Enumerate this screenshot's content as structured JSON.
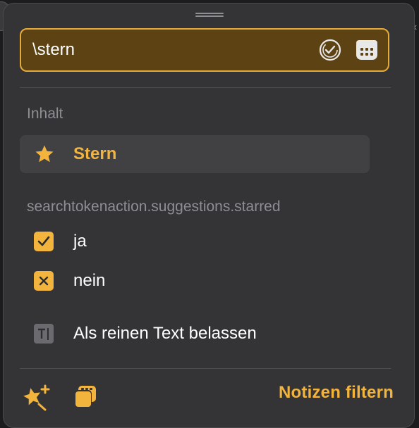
{
  "search": {
    "value": "\\stern",
    "placeholder": ""
  },
  "sections": {
    "content_label": "Inhalt",
    "starred_label": "searchtokenaction.suggestions.starred"
  },
  "items": {
    "star": "Stern",
    "yes": "ja",
    "no": "nein",
    "plain_text": "Als reinen Text belassen"
  },
  "footer": {
    "filter_label": "Notizen filtern"
  },
  "colors": {
    "accent": "#f3b43e",
    "panel": "#343437",
    "search_bg": "#5d4314"
  },
  "icons": [
    "check-circle-icon",
    "calendar-icon",
    "star-icon",
    "checkbox-checked-icon",
    "checkbox-x-icon",
    "text-cursor-icon",
    "star-add-icon",
    "stack-icon"
  ]
}
